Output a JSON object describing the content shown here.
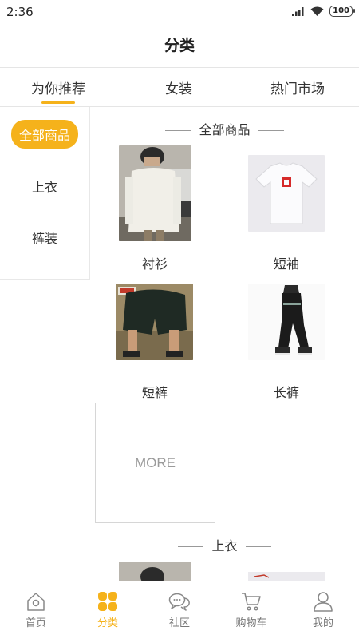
{
  "status_bar": {
    "time": "2:36",
    "battery": "100"
  },
  "header": {
    "title": "分类"
  },
  "top_tabs": [
    {
      "label": "为你推荐",
      "active": true
    },
    {
      "label": "女装",
      "active": false
    },
    {
      "label": "热门市场",
      "active": false
    }
  ],
  "sidebar": {
    "items": [
      {
        "label": "全部商品",
        "active": true
      },
      {
        "label": "上衣",
        "active": false
      },
      {
        "label": "裤装",
        "active": false
      }
    ]
  },
  "sections": [
    {
      "title": "全部商品",
      "products": [
        {
          "name": "衬衫",
          "image": "shirt-photo"
        },
        {
          "name": "短袖",
          "image": "tshirt-photo"
        },
        {
          "name": "短裤",
          "image": "shorts-photo"
        },
        {
          "name": "长裤",
          "image": "trousers-photo"
        }
      ],
      "more_label": "MORE"
    },
    {
      "title": "上衣"
    }
  ],
  "bottom_nav": [
    {
      "label": "首页",
      "icon": "home-icon",
      "active": false
    },
    {
      "label": "分类",
      "icon": "category-icon",
      "active": true
    },
    {
      "label": "社区",
      "icon": "community-icon",
      "active": false
    },
    {
      "label": "购物车",
      "icon": "cart-icon",
      "active": false
    },
    {
      "label": "我的",
      "icon": "profile-icon",
      "active": false
    }
  ],
  "colors": {
    "accent": "#f5b21b",
    "text": "#333333",
    "muted": "#777777",
    "divider": "#e5e5e5"
  }
}
